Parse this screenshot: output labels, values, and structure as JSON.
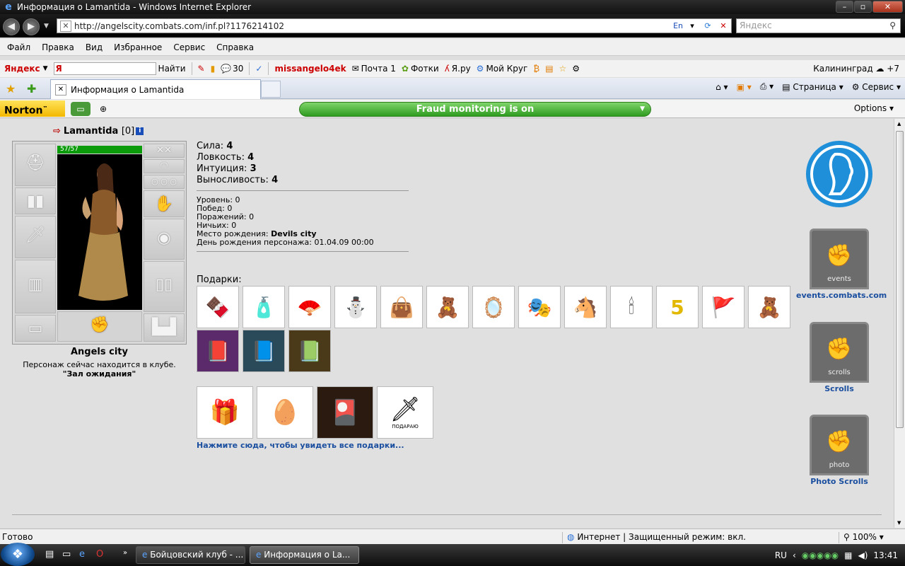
{
  "window": {
    "title": "Информация о Lamantida - Windows Internet Explorer"
  },
  "address": {
    "url": "http://angelscity.combats.com/inf.pl?1176214102",
    "lang": "En",
    "search_placeholder": "Яндекс"
  },
  "menu": [
    "Файл",
    "Правка",
    "Вид",
    "Избранное",
    "Сервис",
    "Справка"
  ],
  "yandex": {
    "logo": "Яндекс",
    "input_value": "Я",
    "find": "Найти",
    "messages": "30",
    "user": "missangelo4ek",
    "mail": "Почта 1",
    "photos": "Фотки",
    "yaru": "Я.ру",
    "mykrug": "Мой Круг",
    "city": "Калининград",
    "temp": "+7"
  },
  "tab": {
    "label": "Информация о Lamantida"
  },
  "commands": {
    "page": "Страница",
    "service": "Сервис"
  },
  "norton": {
    "logo": "Norton",
    "fraud": "Fraud monitoring is on",
    "options": "Options"
  },
  "character": {
    "arrow": "⇨",
    "name": "Lamantida",
    "level_tag": "[0]",
    "info_glyph": "i",
    "hp": "57/57",
    "hp_fraction": 1.0,
    "club": "Angels city",
    "location_text": "Персонаж сейчас находится в клубе.",
    "room": "\"Зал ожидания\""
  },
  "stats": [
    {
      "label": "Сила: ",
      "value": "4"
    },
    {
      "label": "Ловкость: ",
      "value": "4"
    },
    {
      "label": "Интуиция: ",
      "value": "3"
    },
    {
      "label": "Выносливость: ",
      "value": "4"
    }
  ],
  "info": {
    "level": "Уровень: 0",
    "wins": "Побед: 0",
    "losses": "Поражений: 0",
    "draws": "Ничьих: 0",
    "birthplace_label": "Место рождения: ",
    "birthplace": "Devils city",
    "birthday": "День рождения персонажа: 01.04.09 00:00"
  },
  "gifts": {
    "label": "Подарки:",
    "row1": [
      "🍫",
      "🧴",
      "🪭",
      "⛄",
      "👜",
      "🧸",
      "🪞",
      "🎭",
      "🐴",
      "🕯",
      "5",
      "🚩",
      "🧸"
    ],
    "row2": [
      "📕",
      "📘",
      "📗"
    ],
    "large": [
      "🎁",
      "🥚",
      "🎴",
      "🗡"
    ],
    "large_caption": "ПОДАРАЮ",
    "more_link": "Нажмите сюда, чтобы увидеть все подарки..."
  },
  "sidebar": {
    "events_text": "events",
    "events_link": "events.combats.com",
    "scrolls_text": "scrolls",
    "scrolls_link": "Scrolls",
    "photo_text": "photo",
    "photo_link": "Photo Scrolls"
  },
  "status": {
    "ready": "Готово",
    "zone": "Интернет | Защищенный режим: вкл.",
    "zoom": "100%"
  },
  "taskbar": {
    "btn1": "Бойцовский клуб - ...",
    "btn2": "Информация о La...",
    "lang": "RU",
    "time": "13:41"
  },
  "colors": {
    "hp_green": "#0b9b0b",
    "fraud_green": "#2f9b20",
    "link_blue": "#1a4e9f",
    "name_red": "#b00000"
  }
}
